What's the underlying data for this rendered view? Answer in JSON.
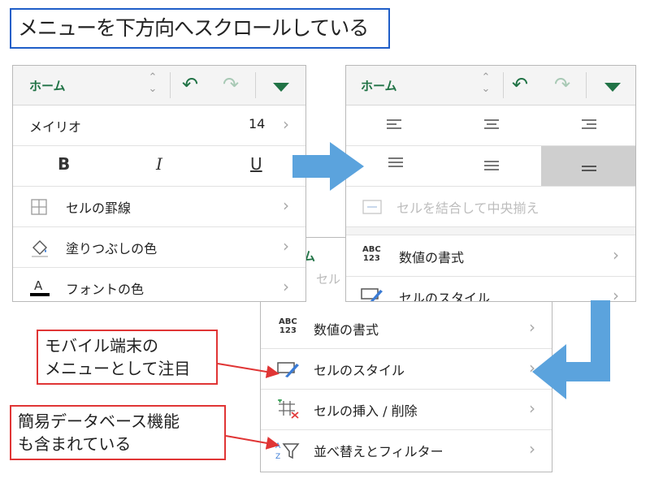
{
  "caption": "メニューを下方向へスクロールしている",
  "panel_left": {
    "tab": "ホーム",
    "font_name": "メイリオ",
    "font_size": "14",
    "bold": "B",
    "italic": "I",
    "underline": "U",
    "items": [
      "セルの罫線",
      "塗りつぶしの色",
      "フォントの色"
    ]
  },
  "panel_right": {
    "tab": "ホーム",
    "merge_center": "セルを結合して中央揃え",
    "items": [
      "数値の書式",
      "セルのスタイル"
    ]
  },
  "panel_bottom": {
    "behind_fragment_1": "ム",
    "behind_fragment_2": "セル",
    "abc_top": "ABC",
    "abc_bottom": "123",
    "items": [
      "数値の書式",
      "セルのスタイル",
      "セルの挿入 / 削除",
      "並べ替えとフィルター"
    ]
  },
  "callouts": {
    "mobile": [
      "モバイル端末の",
      "メニューとして注目"
    ],
    "database": [
      "簡易データベース機能",
      "も含まれている"
    ]
  },
  "colors": {
    "accent": "#217346",
    "arrow": "#5ba3dd",
    "callout": "#e03535",
    "caption_border": "#1f5ec8"
  }
}
